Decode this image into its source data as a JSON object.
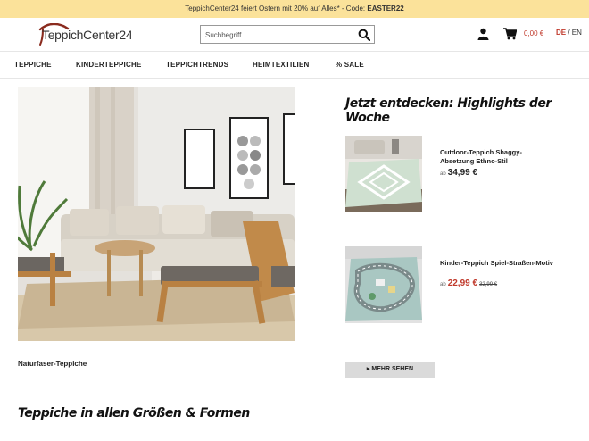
{
  "promo": {
    "text": "TeppichCenter24 feiert Ostern mit 20% auf Alles",
    "suffix": "* - Code: ",
    "code": "EASTER22"
  },
  "header": {
    "logo_text": "TeppichCenter24",
    "search_placeholder": "Suchbegriff...",
    "cart_total": "0,00 €",
    "lang_de": "DE",
    "lang_sep": " / ",
    "lang_en": "EN"
  },
  "nav": {
    "items": [
      {
        "label": "TEPPICHE"
      },
      {
        "label": "KINDERTEPPICHE"
      },
      {
        "label": "TEPPICHTRENDS"
      },
      {
        "label": "HEIMTEXTILIEN"
      },
      {
        "label": "% SALE"
      }
    ]
  },
  "hero": {
    "caption": "Naturfaser-Teppiche"
  },
  "highlights": {
    "title": "Jetzt entdecken: Highlights der Woche",
    "products": [
      {
        "name": "Outdoor-Teppich Shaggy-Absetzung Ethno-Stil",
        "prefix": "ab",
        "price": "34,99 €",
        "old_price": ""
      },
      {
        "name": "Kinder-Teppich Spiel-Straßen-Motiv",
        "prefix": "ab",
        "price": "22,99 €",
        "old_price": "32,99 €"
      }
    ],
    "more_label": "MEHR SEHEN"
  },
  "section": {
    "title": "Teppiche in allen Größen & Formen"
  },
  "colors": {
    "promo_bg": "#fbe29a",
    "accent_red": "#c0392b"
  }
}
